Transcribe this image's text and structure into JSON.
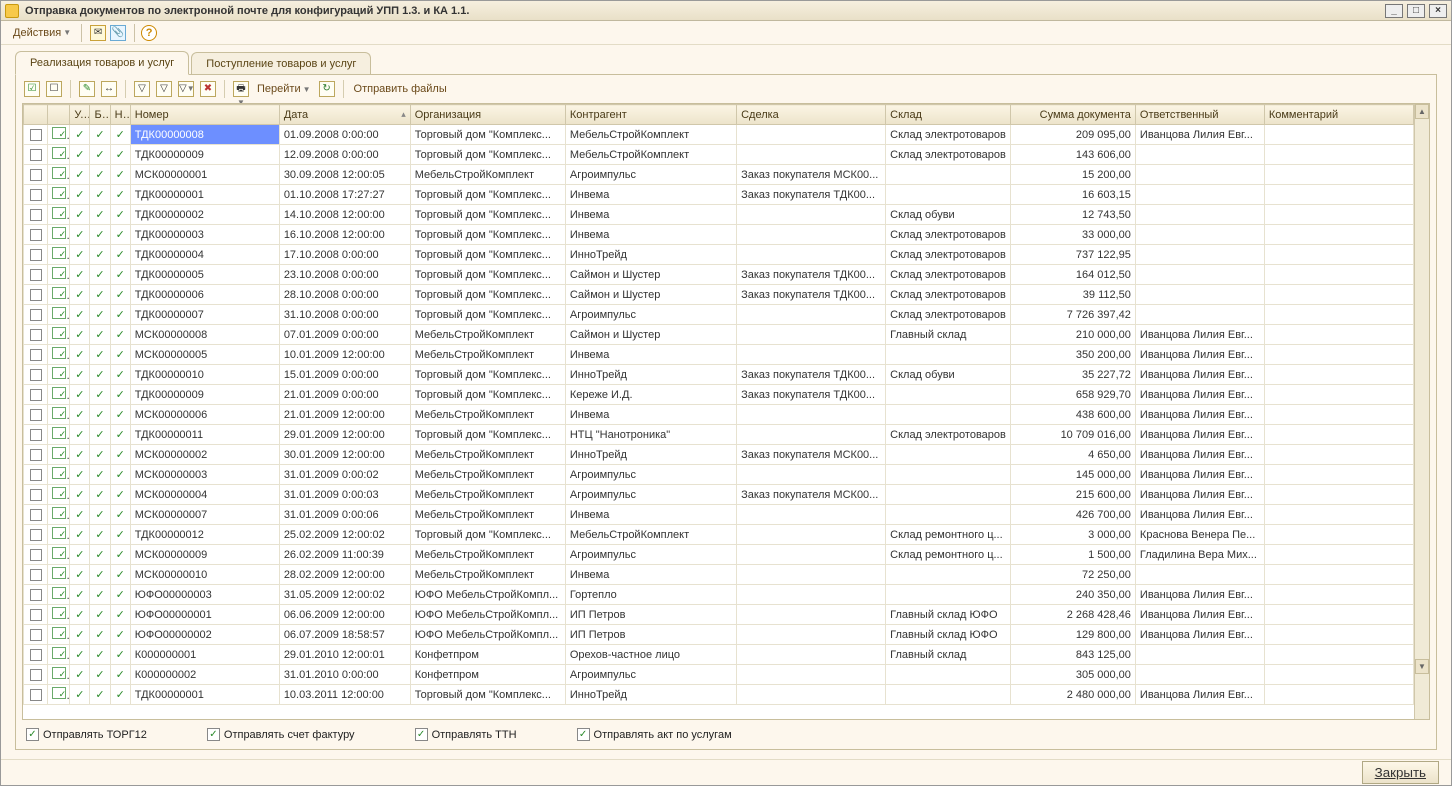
{
  "window_title": "Отправка документов по электронной почте для конфигураций УПП 1.3. и КА 1.1.",
  "toolbar": {
    "actions_label": "Действия"
  },
  "tabs": [
    {
      "label": "Реализация товаров и услуг",
      "active": true
    },
    {
      "label": "Поступление товаров и услуг",
      "active": false
    }
  ],
  "inner_toolbar": {
    "goto_label": "Перейти",
    "send_label": "Отправить файлы"
  },
  "columns": {
    "u": "У..",
    "b": "Б..",
    "n": "Н..",
    "number": "Номер",
    "date": "Дата",
    "org": "Организация",
    "contr": "Контрагент",
    "deal": "Сделка",
    "wh": "Склад",
    "sum": "Сумма документа",
    "resp": "Ответственный",
    "comm": "Комментарий"
  },
  "rows": [
    {
      "u": true,
      "b": true,
      "n": true,
      "number": "ТДК00000008",
      "date": "01.09.2008 0:00:00",
      "org": "Торговый дом \"Комплекс...",
      "contr": "МебельСтройКомплект",
      "deal": "",
      "wh": "Склад электротоваров",
      "sum": "209 095,00",
      "resp": "Иванцова Лилия Евг...",
      "comm": ""
    },
    {
      "u": true,
      "b": true,
      "n": true,
      "number": "ТДК00000009",
      "date": "12.09.2008 0:00:00",
      "org": "Торговый дом \"Комплекс...",
      "contr": "МебельСтройКомплект",
      "deal": "",
      "wh": "Склад электротоваров",
      "sum": "143 606,00",
      "resp": "",
      "comm": ""
    },
    {
      "u": true,
      "b": true,
      "n": true,
      "number": "МСК00000001",
      "date": "30.09.2008 12:00:05",
      "org": "МебельСтройКомплект",
      "contr": "Агроимпульс",
      "deal": "Заказ покупателя МСК00...",
      "wh": "",
      "sum": "15 200,00",
      "resp": "",
      "comm": ""
    },
    {
      "u": true,
      "b": true,
      "n": true,
      "number": "ТДК00000001",
      "date": "01.10.2008 17:27:27",
      "org": "Торговый дом \"Комплекс...",
      "contr": "Инвема",
      "deal": "Заказ покупателя ТДК00...",
      "wh": "",
      "sum": "16 603,15",
      "resp": "",
      "comm": ""
    },
    {
      "u": true,
      "b": true,
      "n": true,
      "number": "ТДК00000002",
      "date": "14.10.2008 12:00:00",
      "org": "Торговый дом \"Комплекс...",
      "contr": "Инвема",
      "deal": "",
      "wh": "Склад обуви",
      "sum": "12 743,50",
      "resp": "",
      "comm": ""
    },
    {
      "u": true,
      "b": true,
      "n": true,
      "number": "ТДК00000003",
      "date": "16.10.2008 12:00:00",
      "org": "Торговый дом \"Комплекс...",
      "contr": "Инвема",
      "deal": "",
      "wh": "Склад электротоваров",
      "sum": "33 000,00",
      "resp": "",
      "comm": ""
    },
    {
      "u": true,
      "b": true,
      "n": true,
      "number": "ТДК00000004",
      "date": "17.10.2008 0:00:00",
      "org": "Торговый дом \"Комплекс...",
      "contr": "ИнноТрейд",
      "deal": "",
      "wh": "Склад электротоваров",
      "sum": "737 122,95",
      "resp": "",
      "comm": ""
    },
    {
      "u": true,
      "b": true,
      "n": true,
      "number": "ТДК00000005",
      "date": "23.10.2008 0:00:00",
      "org": "Торговый дом \"Комплекс...",
      "contr": "Саймон и Шустер",
      "deal": "Заказ покупателя ТДК00...",
      "wh": "Склад электротоваров",
      "sum": "164 012,50",
      "resp": "",
      "comm": ""
    },
    {
      "u": true,
      "b": true,
      "n": true,
      "number": "ТДК00000006",
      "date": "28.10.2008 0:00:00",
      "org": "Торговый дом \"Комплекс...",
      "contr": "Саймон и Шустер",
      "deal": "Заказ покупателя ТДК00...",
      "wh": "Склад электротоваров",
      "sum": "39 112,50",
      "resp": "",
      "comm": ""
    },
    {
      "u": true,
      "b": true,
      "n": true,
      "number": "ТДК00000007",
      "date": "31.10.2008 0:00:00",
      "org": "Торговый дом \"Комплекс...",
      "contr": "Агроимпульс",
      "deal": "",
      "wh": "Склад электротоваров",
      "sum": "7 726 397,42",
      "resp": "",
      "comm": ""
    },
    {
      "u": true,
      "b": true,
      "n": true,
      "number": "МСК00000008",
      "date": "07.01.2009 0:00:00",
      "org": "МебельСтройКомплект",
      "contr": "Саймон и Шустер",
      "deal": "",
      "wh": "Главный склад",
      "sum": "210 000,00",
      "resp": "Иванцова Лилия Евг...",
      "comm": ""
    },
    {
      "u": true,
      "b": true,
      "n": true,
      "number": "МСК00000005",
      "date": "10.01.2009 12:00:00",
      "org": "МебельСтройКомплект",
      "contr": "Инвема",
      "deal": "",
      "wh": "",
      "sum": "350 200,00",
      "resp": "Иванцова Лилия Евг...",
      "comm": ""
    },
    {
      "u": true,
      "b": true,
      "n": true,
      "number": "ТДК00000010",
      "date": "15.01.2009 0:00:00",
      "org": "Торговый дом \"Комплекс...",
      "contr": "ИнноТрейд",
      "deal": "Заказ покупателя ТДК00...",
      "wh": "Склад обуви",
      "sum": "35 227,72",
      "resp": "Иванцова Лилия Евг...",
      "comm": ""
    },
    {
      "u": true,
      "b": true,
      "n": true,
      "number": "ТДК00000009",
      "date": "21.01.2009 0:00:00",
      "org": "Торговый дом \"Комплекс...",
      "contr": "Кереже И.Д.",
      "deal": "Заказ покупателя ТДК00...",
      "wh": "",
      "sum": "658 929,70",
      "resp": "Иванцова Лилия Евг...",
      "comm": ""
    },
    {
      "u": true,
      "b": true,
      "n": true,
      "number": "МСК00000006",
      "date": "21.01.2009 12:00:00",
      "org": "МебельСтройКомплект",
      "contr": "Инвема",
      "deal": "",
      "wh": "",
      "sum": "438 600,00",
      "resp": "Иванцова Лилия Евг...",
      "comm": ""
    },
    {
      "u": true,
      "b": true,
      "n": true,
      "number": "ТДК00000011",
      "date": "29.01.2009 12:00:00",
      "org": "Торговый дом \"Комплекс...",
      "contr": "НТЦ \"Нанотроника\"",
      "deal": "",
      "wh": "Склад электротоваров",
      "sum": "10 709 016,00",
      "resp": "Иванцова Лилия Евг...",
      "comm": ""
    },
    {
      "u": true,
      "b": true,
      "n": true,
      "number": "МСК00000002",
      "date": "30.01.2009 12:00:00",
      "org": "МебельСтройКомплект",
      "contr": "ИнноТрейд",
      "deal": "Заказ покупателя МСК00...",
      "wh": "",
      "sum": "4 650,00",
      "resp": "Иванцова Лилия Евг...",
      "comm": ""
    },
    {
      "u": true,
      "b": true,
      "n": true,
      "number": "МСК00000003",
      "date": "31.01.2009 0:00:02",
      "org": "МебельСтройКомплект",
      "contr": "Агроимпульс",
      "deal": "",
      "wh": "",
      "sum": "145 000,00",
      "resp": "Иванцова Лилия Евг...",
      "comm": ""
    },
    {
      "u": true,
      "b": true,
      "n": true,
      "number": "МСК00000004",
      "date": "31.01.2009 0:00:03",
      "org": "МебельСтройКомплект",
      "contr": "Агроимпульс",
      "deal": "Заказ покупателя МСК00...",
      "wh": "",
      "sum": "215 600,00",
      "resp": "Иванцова Лилия Евг...",
      "comm": ""
    },
    {
      "u": true,
      "b": true,
      "n": true,
      "number": "МСК00000007",
      "date": "31.01.2009 0:00:06",
      "org": "МебельСтройКомплект",
      "contr": "Инвема",
      "deal": "",
      "wh": "",
      "sum": "426 700,00",
      "resp": "Иванцова Лилия Евг...",
      "comm": ""
    },
    {
      "u": true,
      "b": true,
      "n": true,
      "number": "ТДК00000012",
      "date": "25.02.2009 12:00:02",
      "org": "Торговый дом \"Комплекс...",
      "contr": "МебельСтройКомплект",
      "deal": "",
      "wh": "Склад ремонтного ц...",
      "sum": "3 000,00",
      "resp": "Краснова Венера Пе...",
      "comm": ""
    },
    {
      "u": true,
      "b": true,
      "n": true,
      "number": "МСК00000009",
      "date": "26.02.2009 11:00:39",
      "org": "МебельСтройКомплект",
      "contr": "Агроимпульс",
      "deal": "",
      "wh": "Склад ремонтного ц...",
      "sum": "1 500,00",
      "resp": "Гладилина Вера Мих...",
      "comm": ""
    },
    {
      "u": true,
      "b": true,
      "n": true,
      "number": "МСК00000010",
      "date": "28.02.2009 12:00:00",
      "org": "МебельСтройКомплект",
      "contr": "Инвема",
      "deal": "",
      "wh": "",
      "sum": "72 250,00",
      "resp": "",
      "comm": ""
    },
    {
      "u": true,
      "b": true,
      "n": true,
      "number": "ЮФО00000003",
      "date": "31.05.2009 12:00:02",
      "org": "ЮФО МебельСтройКомпл...",
      "contr": "Гортепло",
      "deal": "",
      "wh": "",
      "sum": "240 350,00",
      "resp": "Иванцова Лилия Евг...",
      "comm": ""
    },
    {
      "u": true,
      "b": true,
      "n": true,
      "number": "ЮФО00000001",
      "date": "06.06.2009 12:00:00",
      "org": "ЮФО МебельСтройКомпл...",
      "contr": "ИП Петров",
      "deal": "",
      "wh": "Главный склад ЮФО",
      "sum": "2 268 428,46",
      "resp": "Иванцова Лилия Евг...",
      "comm": ""
    },
    {
      "u": true,
      "b": true,
      "n": true,
      "number": "ЮФО00000002",
      "date": "06.07.2009 18:58:57",
      "org": "ЮФО МебельСтройКомпл...",
      "contr": "ИП Петров",
      "deal": "",
      "wh": "Главный склад ЮФО",
      "sum": "129 800,00",
      "resp": "Иванцова Лилия Евг...",
      "comm": ""
    },
    {
      "u": true,
      "b": true,
      "n": true,
      "number": "К000000001",
      "date": "29.01.2010 12:00:01",
      "org": "Конфетпром",
      "contr": "Орехов-частное лицо",
      "deal": "",
      "wh": "Главный склад",
      "sum": "843 125,00",
      "resp": "",
      "comm": ""
    },
    {
      "u": true,
      "b": true,
      "n": true,
      "number": "К000000002",
      "date": "31.01.2010 0:00:00",
      "org": "Конфетпром",
      "contr": "Агроимпульс",
      "deal": "",
      "wh": "",
      "sum": "305 000,00",
      "resp": "",
      "comm": ""
    },
    {
      "u": true,
      "b": true,
      "n": true,
      "number": "ТДК00000001",
      "date": "10.03.2011 12:00:00",
      "org": "Торговый дом \"Комплекс...",
      "contr": "ИнноТрейд",
      "deal": "",
      "wh": "",
      "sum": "2 480 000,00",
      "resp": "Иванцова Лилия Евг...",
      "comm": ""
    }
  ],
  "footer": {
    "send_torg12": "Отправлять ТОРГ12",
    "send_invoice": "Отправлять счет фактуру",
    "send_ttn": "Отправлять ТТН",
    "send_act": "Отправлять акт по услугам"
  },
  "close_label": "Закрыть"
}
